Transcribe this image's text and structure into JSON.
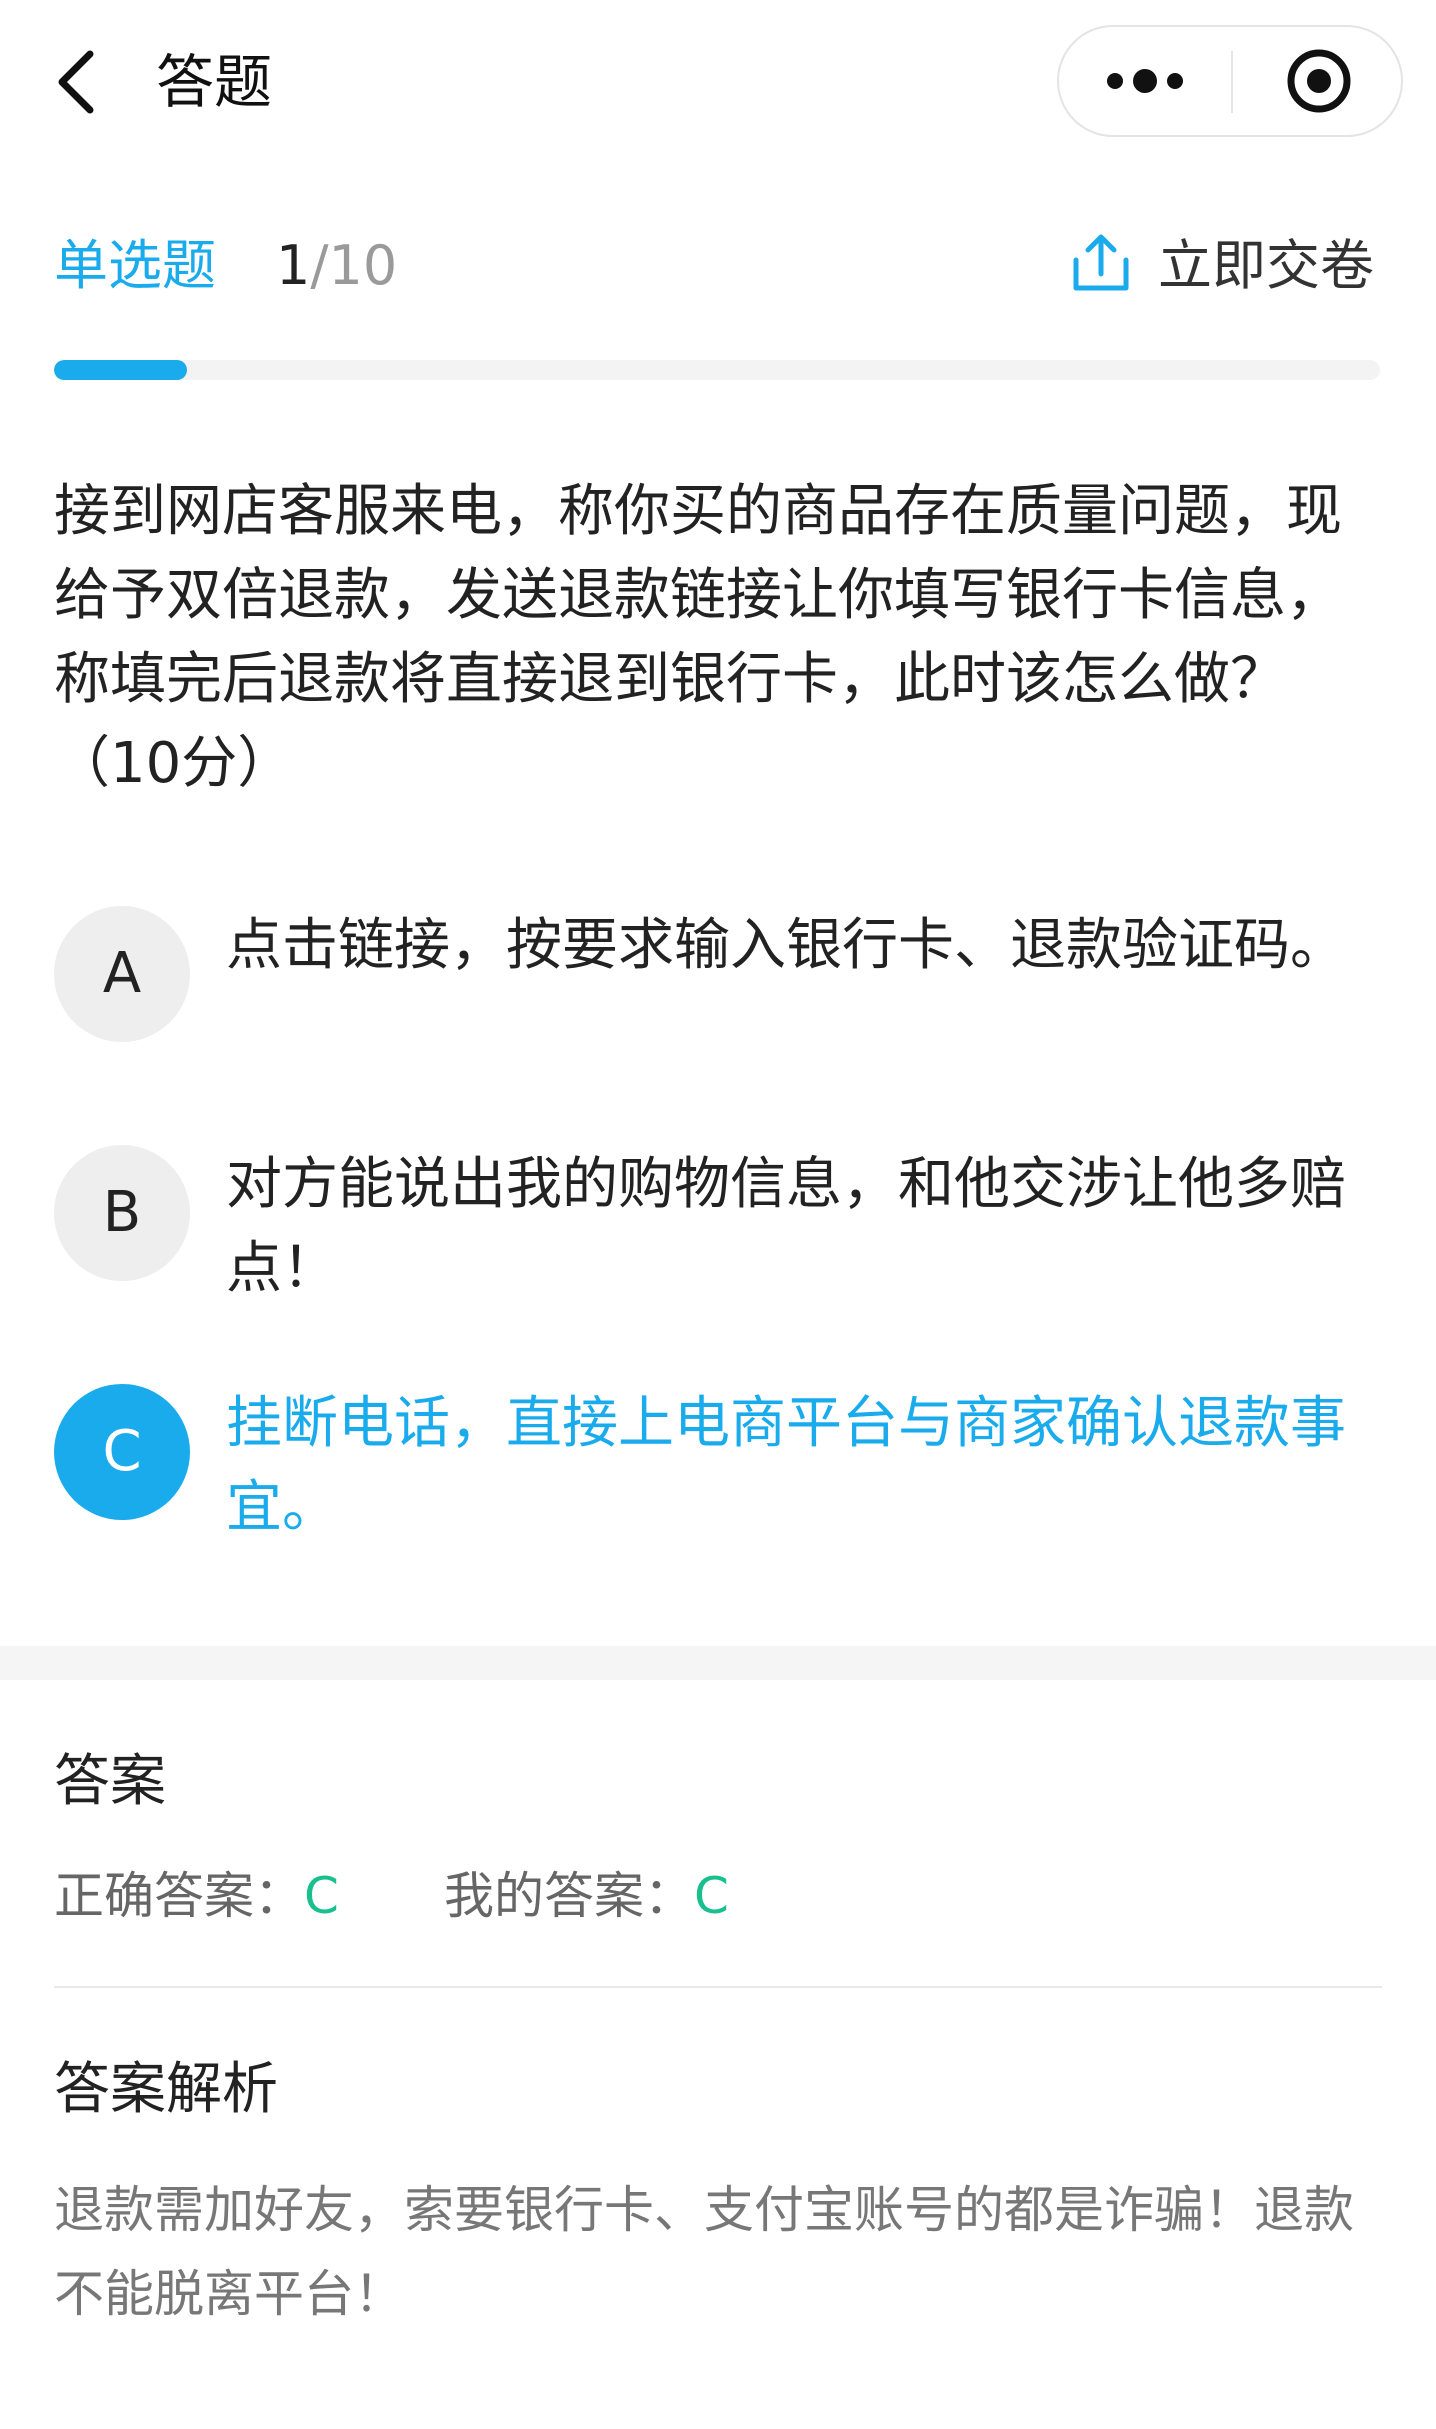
{
  "navbar": {
    "title": "答题"
  },
  "header": {
    "question_type": "单选题",
    "current": "1",
    "total": "/10",
    "progress": 0.1,
    "submit_label": "立即交卷"
  },
  "question": {
    "text": "接到网店客服来电，称你买的商品存在质量问题，现给予双倍退款，发送退款链接让你填写银行卡信息，称填完后退款将直接退到银行卡，此时该怎么做？（10分）"
  },
  "options": [
    {
      "key": "A",
      "text": "点击链接，按要求输入银行卡、退款验证码。",
      "selected": false
    },
    {
      "key": "B",
      "text": "对方能说出我的购物信息，和他交涉让他多赔点！",
      "selected": false
    },
    {
      "key": "C",
      "text": "挂断电话，直接上电商平台与商家确认退款事宜。",
      "selected": true
    }
  ],
  "answer": {
    "title": "答案",
    "correct_label": "正确答案：",
    "correct_value": "C",
    "mine_label": "我的答案：",
    "mine_value": "C"
  },
  "analysis": {
    "title": "答案解析",
    "text": "退款需加好友，索要银行卡、支付宝账号的都是诈骗！退款不能脱离平台！"
  },
  "colors": {
    "accent": "#1aabec",
    "correct": "#19c08e"
  },
  "icons": {
    "back": "chevron-left-icon",
    "more": "more-dots-icon",
    "close": "target-circle-icon",
    "submit": "upload-icon"
  }
}
